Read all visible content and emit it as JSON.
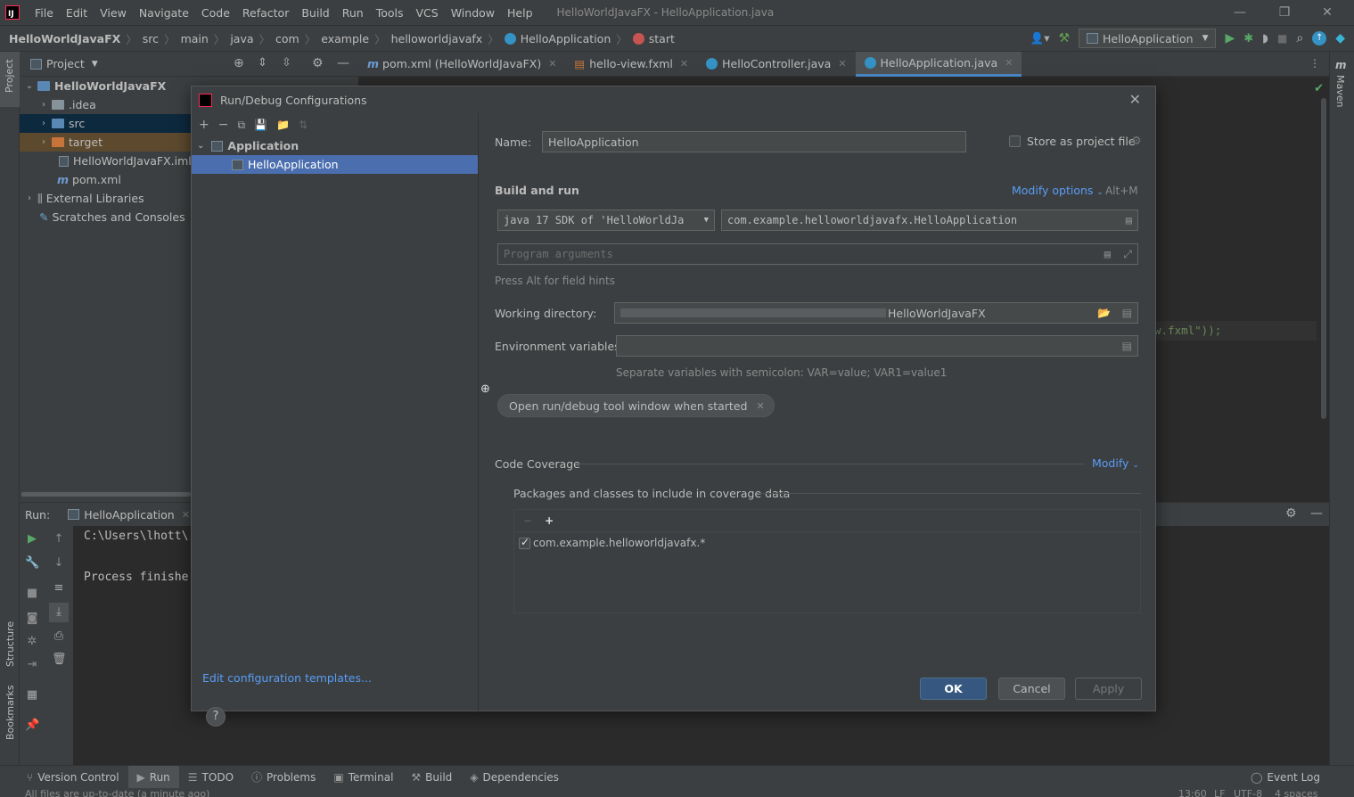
{
  "menubar": {
    "items": [
      "File",
      "Edit",
      "View",
      "Navigate",
      "Code",
      "Refactor",
      "Build",
      "Run",
      "Tools",
      "VCS",
      "Window",
      "Help"
    ],
    "window_title": "HelloWorldJavaFX - HelloApplication.java"
  },
  "navbar": {
    "crumbs": [
      "HelloWorldJavaFX",
      "src",
      "main",
      "java",
      "com",
      "example",
      "helloworldjavafx",
      "HelloApplication",
      "start"
    ],
    "run_config": "HelloApplication"
  },
  "project": {
    "header": "Project",
    "tree": [
      {
        "label": "HelloWorldJavaFX"
      },
      {
        "label": ".idea"
      },
      {
        "label": "src"
      },
      {
        "label": "target"
      },
      {
        "label": "HelloWorldJavaFX.iml"
      },
      {
        "label": "pom.xml"
      },
      {
        "label": "External Libraries"
      },
      {
        "label": "Scratches and Consoles"
      }
    ]
  },
  "editor": {
    "tabs": [
      "pom.xml (HelloWorldJavaFX)",
      "hello-view.fxml",
      "HelloController.java",
      "HelloApplication.java"
    ],
    "visible_code": "w.fxml\"));"
  },
  "run": {
    "label": "Run:",
    "tab": "HelloApplication",
    "console_line1": "C:\\Users\\lhott\\",
    "console_line2": "Process finishe"
  },
  "left_strip": {
    "project": "Project",
    "structure": "Structure",
    "bookmarks": "Bookmarks"
  },
  "right_strip": {
    "maven": "Maven"
  },
  "toolwindows": [
    "Version Control",
    "Run",
    "TODO",
    "Problems",
    "Terminal",
    "Build",
    "Dependencies"
  ],
  "event_log": "Event Log",
  "status": {
    "message": "All files are up-to-date (a minute ago)",
    "position": "13:60",
    "line_sep": "LF",
    "encoding": "UTF-8",
    "indent": "4 spaces"
  },
  "dialog": {
    "title": "Run/Debug Configurations",
    "tree": {
      "group": "Application",
      "item": "HelloApplication"
    },
    "edit_templates": "Edit configuration templates...",
    "help": "?",
    "name_label": "Name:",
    "name_value": "HelloApplication",
    "store_label": "Store as project file",
    "build_run": "Build and run",
    "modify_options": "Modify options",
    "modify_shortcut": "Alt+M",
    "sdk_value": "java 17 SDK of 'HelloWorldJa",
    "main_class": "com.example.helloworldjavafx.HelloApplication",
    "program_args_placeholder": "Program arguments",
    "field_hint": "Press Alt for field hints",
    "workdir_label": "Working directory:",
    "workdir_value": "HelloWorldJavaFX",
    "env_label": "Environment variables:",
    "env_value": "",
    "env_hint": "Separate variables with semicolon: VAR=value; VAR1=value1",
    "chip": "Open run/debug tool window when started",
    "coverage": "Code Coverage",
    "coverage_modify": "Modify",
    "packages_label": "Packages and classes to include in coverage data",
    "package_entry": "com.example.helloworldjavafx.*",
    "ok": "OK",
    "cancel": "Cancel",
    "apply": "Apply"
  }
}
